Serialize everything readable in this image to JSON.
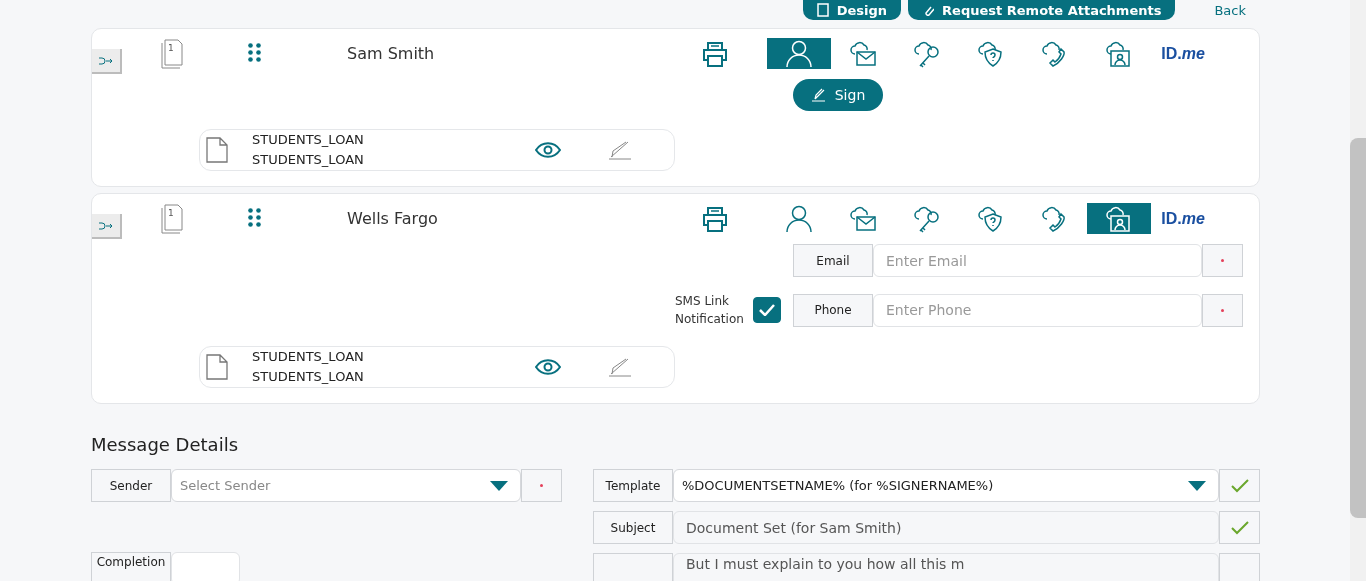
{
  "toolbar": {
    "buttons": [
      {
        "label": "Design",
        "kind": "design"
      },
      {
        "label": "Request Remote Attachments",
        "kind": "attach"
      }
    ],
    "back_link": "Back"
  },
  "signers": [
    {
      "name": "Sam Smith",
      "page_count": "1",
      "auth_methods": [
        {
          "kind": "person",
          "selected": true
        },
        {
          "kind": "email",
          "selected": false
        },
        {
          "kind": "key",
          "selected": false
        },
        {
          "kind": "shield",
          "selected": false
        },
        {
          "kind": "phone",
          "selected": false
        },
        {
          "kind": "idcard",
          "selected": false
        },
        {
          "kind": "idme",
          "label": "ID.*me*",
          "selected": false
        }
      ],
      "action": {
        "kind": "sign",
        "label": "Sign"
      },
      "document": {
        "lines": [
          "STUDENTS_LOAN",
          "STUDENTS_LOAN"
        ]
      }
    },
    {
      "name": "Wells Fargo",
      "page_count": "1",
      "auth_methods": [
        {
          "kind": "person",
          "selected": false
        },
        {
          "kind": "email",
          "selected": false
        },
        {
          "kind": "key",
          "selected": false
        },
        {
          "kind": "shield",
          "selected": false
        },
        {
          "kind": "phone",
          "selected": false
        },
        {
          "kind": "idcard",
          "selected": true
        },
        {
          "kind": "idme",
          "label": "ID.*me*",
          "selected": false
        }
      ],
      "action": {
        "kind": "contact",
        "sms_notification": {
          "label": "SMS Link Notification",
          "checked": true
        },
        "fields": [
          {
            "label": "Email",
            "placeholder": "Enter Email",
            "required": true
          },
          {
            "label": "Phone",
            "placeholder": "Enter Phone",
            "required": true
          }
        ]
      },
      "document": {
        "lines": [
          "STUDENTS_LOAN",
          "STUDENTS_LOAN"
        ]
      }
    }
  ],
  "message_details": {
    "title": "Message Details",
    "sender": {
      "label": "Sender",
      "placeholder": "Select Sender",
      "required": true
    },
    "completion": {
      "label": "Completion"
    },
    "template": {
      "label": "Template",
      "value": "%DOCUMENTSETNAME% (for %SIGNERNAME%)",
      "valid": true
    },
    "subject": {
      "label": "Subject",
      "value": "Document Set (for Sam Smith)",
      "valid": true
    },
    "message": {
      "value": "But I must explain to you how all this m"
    }
  }
}
